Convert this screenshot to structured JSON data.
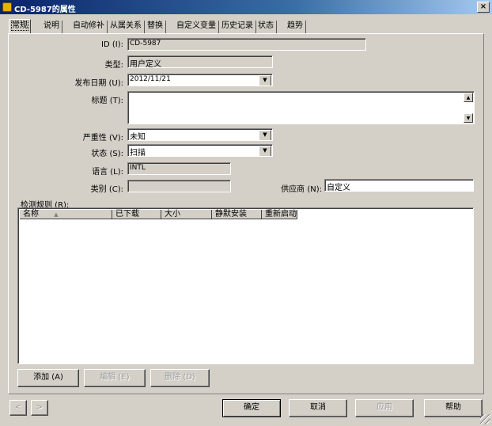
{
  "window": {
    "title": "CD-5987的属性",
    "close": "×"
  },
  "tabs": [
    "常规",
    "说明",
    "自动修补",
    "从属关系",
    "替换",
    "自定义变量",
    "历史记录",
    "状态",
    "趋势"
  ],
  "general": {
    "id": {
      "label": "ID (I):",
      "value": "CD-5987"
    },
    "type": {
      "label": "类型:",
      "value": "用户定义"
    },
    "release_date": {
      "label": "发布日期 (U):",
      "value": "2012/11/21"
    },
    "title": {
      "label": "标题 (T):",
      "value": ""
    },
    "severity": {
      "label": "严重性 (V):",
      "value": "未知"
    },
    "status": {
      "label": "状态 (S):",
      "value": "扫描"
    },
    "language": {
      "label": "语言 (L):",
      "value": "INTL"
    },
    "category": {
      "label": "类别 (C):",
      "value": ""
    },
    "vendor": {
      "label": "供应商 (N):",
      "value": "自定义"
    }
  },
  "detection_rules": {
    "label": "检测规则 (R):",
    "columns": [
      "名称",
      "已下载",
      "大小",
      "静默安装",
      "重新启动"
    ],
    "sort_indicator": "▲",
    "rows": []
  },
  "rule_buttons": {
    "add": "添加 (A)",
    "edit": "编辑 (E)",
    "delete": "删除 (D)"
  },
  "footer": {
    "prev": "<",
    "next": ">",
    "ok": "确定",
    "cancel": "取消",
    "apply": "应用",
    "help": "帮助"
  },
  "icons": {
    "dropdown": "▼",
    "scroll_up": "▲",
    "scroll_down": "▼"
  }
}
